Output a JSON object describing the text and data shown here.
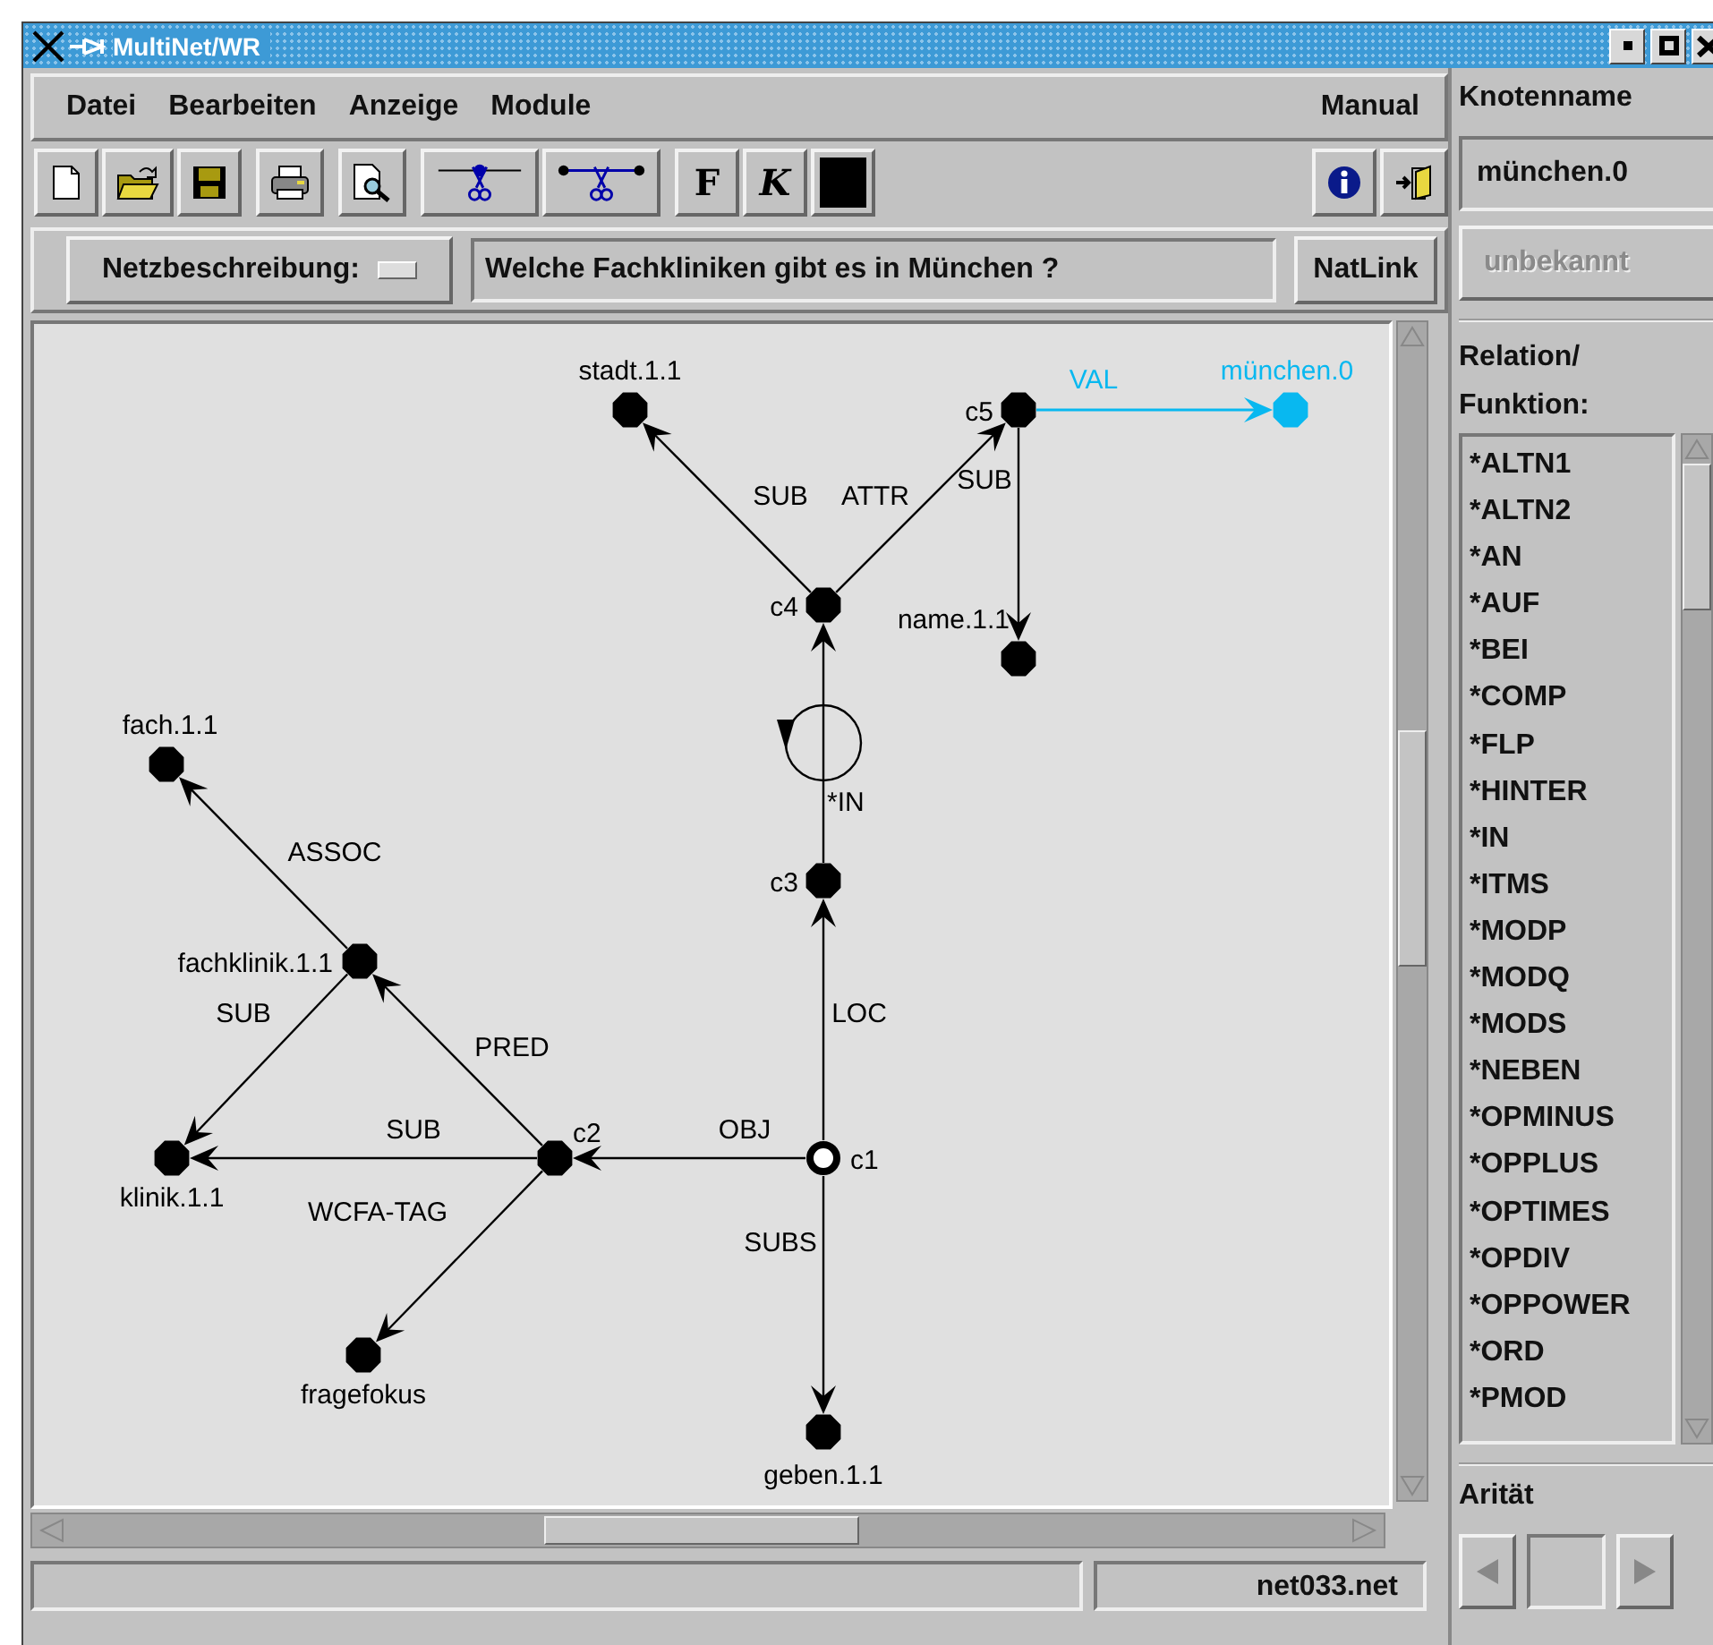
{
  "window": {
    "title": "MultiNet/WR"
  },
  "menu": [
    "Datei",
    "Bearbeiten",
    "Anzeige",
    "Module"
  ],
  "menu_right": "Manual",
  "toolbar": {
    "text_buttons": [
      "F",
      "K"
    ]
  },
  "query": {
    "selector": "Netzbeschreibung:",
    "value": "Welche Fachkliniken gibt es in München ?",
    "button": "NatLink"
  },
  "graph": {
    "nodes": [
      {
        "label": "stadt.1.1",
        "kind": "concept"
      },
      {
        "label": "c5",
        "kind": "concept"
      },
      {
        "label": "münchen.0",
        "kind": "value"
      },
      {
        "label": "c4",
        "kind": "concept"
      },
      {
        "label": "name.1.1",
        "kind": "concept"
      },
      {
        "label": "fach.1.1",
        "kind": "concept"
      },
      {
        "label": "c3",
        "kind": "concept"
      },
      {
        "label": "fachklinik.1.1",
        "kind": "concept"
      },
      {
        "label": "klinik.1.1",
        "kind": "concept"
      },
      {
        "label": "c2",
        "kind": "concept"
      },
      {
        "label": "c1",
        "kind": "hollow"
      },
      {
        "label": "fragefokus",
        "kind": "concept"
      },
      {
        "label": "geben.1.1",
        "kind": "concept"
      }
    ],
    "edges": [
      {
        "label": "SUB",
        "kind": "relation"
      },
      {
        "label": "ATTR",
        "kind": "relation"
      },
      {
        "label": "VAL",
        "kind": "value"
      },
      {
        "label": "SUB",
        "kind": "relation"
      },
      {
        "label": "*IN",
        "kind": "function"
      },
      {
        "label": "LOC",
        "kind": "relation"
      },
      {
        "label": "OBJ",
        "kind": "relation"
      },
      {
        "label": "SUBS",
        "kind": "relation"
      },
      {
        "label": "PRED",
        "kind": "relation"
      },
      {
        "label": "SUB",
        "kind": "relation"
      },
      {
        "label": "WCFA-TAG",
        "kind": "relation"
      },
      {
        "label": "SUB",
        "kind": "relation"
      },
      {
        "label": "ASSOC",
        "kind": "relation"
      }
    ]
  },
  "status_bar": {
    "file": "net033.net"
  },
  "side": {
    "node_name_label": "Knotenname",
    "node_name": "münchen.0",
    "type_button": {
      "label": "unbekannt",
      "disabled": true
    },
    "relation_label": [
      "Relation/",
      "Funktion:"
    ],
    "relations": [
      "*ALTN1",
      "*ALTN2",
      "*AN",
      "*AUF",
      "*BEI",
      "*COMP",
      "*FLP",
      "*HINTER",
      "*IN",
      "*ITMS",
      "*MODP",
      "*MODQ",
      "*MODS",
      "*NEBEN",
      "*OPMINUS",
      "*OPPLUS",
      "*OPTIMES",
      "*OPDIV",
      "*OPPOWER",
      "*ORD",
      "*PMOD"
    ],
    "arity_label": "Arität"
  }
}
